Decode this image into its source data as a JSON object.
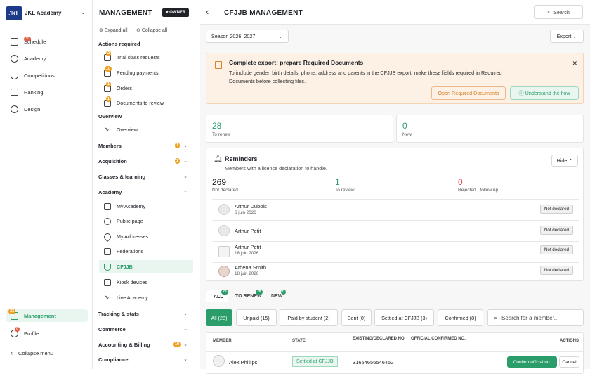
{
  "nav": {
    "logo": "JKL",
    "academy": "JKL Academy",
    "items": [
      {
        "label": "Schedule",
        "badge": "30"
      },
      {
        "label": "Academy",
        "badge": ""
      },
      {
        "label": "Competitions",
        "badge": ""
      },
      {
        "label": "Ranking",
        "badge": ""
      },
      {
        "label": "Design",
        "badge": ""
      }
    ],
    "management": {
      "label": "Management",
      "badge": "33"
    },
    "profile": {
      "label": "Profile",
      "badge": "6"
    },
    "collapse": "Collapse menu"
  },
  "mg": {
    "title": "MANAGEMENT",
    "owner": "OWNER",
    "expand": "Expand all",
    "collapse": "Collapse all",
    "actions_title": "Actions required",
    "actions": [
      {
        "label": "Trial class requests",
        "badge": "2"
      },
      {
        "label": "Pending payments",
        "badge": "10"
      },
      {
        "label": "Orders",
        "badge": "1"
      },
      {
        "label": "Documents to review",
        "badge": "1"
      }
    ],
    "overview_title": "Overview",
    "overview_item": "Overview",
    "sections": [
      {
        "label": "Members",
        "badge": "1"
      },
      {
        "label": "Acquisition",
        "badge": "1"
      },
      {
        "label": "Classes & learning",
        "badge": ""
      },
      {
        "label": "Academy",
        "badge": ""
      }
    ],
    "academy_items": [
      "My Academy",
      "Public page",
      "My Addresses",
      "Federations",
      "CFJJB",
      "Kiosk devices",
      "Live Academy"
    ],
    "bottom_sections": [
      {
        "label": "Tracking & stats",
        "badge": ""
      },
      {
        "label": "Commerce",
        "badge": ""
      },
      {
        "label": "Accounting & Billing",
        "badge": "10"
      },
      {
        "label": "Compliance",
        "badge": ""
      }
    ]
  },
  "main": {
    "title": "CFJJB MANAGEMENT",
    "search": "Search",
    "season": "Season 2026–2027",
    "export": "Export",
    "alert": {
      "title": "Complete export: prepare Required Documents",
      "text": "To include gender, birth details, phone, address and parents in the CFJJB export, make these fields required in Required Documents before collecting files.",
      "btn1": "Open Required Documents",
      "btn2": "Understand the flow"
    },
    "stats": [
      {
        "value": "28",
        "label": "To renew"
      },
      {
        "value": "0",
        "label": "New"
      }
    ],
    "reminders": {
      "title": "Reminders",
      "subtitle": "Members with a licence declaration to handle.",
      "hide": "Hide",
      "counts": [
        {
          "value": "269",
          "label": "Not declared"
        },
        {
          "value": "1",
          "label": "To review"
        },
        {
          "value": "0",
          "label": "Rejected · follow up"
        }
      ],
      "rows": [
        {
          "name": "Arthur Dubois",
          "date": "6 juin 2026",
          "status": "Not declared"
        },
        {
          "name": "Arthur Petit",
          "date": "",
          "status": "Not declared"
        },
        {
          "name": "Arthur Petit",
          "date": "18 juin 2026",
          "status": "Not declared"
        },
        {
          "name": "Athena Smith",
          "date": "18 juin 2026",
          "status": "Not declared"
        }
      ]
    },
    "tabs": [
      {
        "label": "ALL",
        "count": "28"
      },
      {
        "label": "TO RENEW",
        "count": "28"
      },
      {
        "label": "NEW",
        "count": "0"
      }
    ],
    "filters": [
      "All (28)",
      "Unpaid (15)",
      "Paid by student (2)",
      "Sent (0)",
      "Settled at CFJJB (3)",
      "Confirmed (8)"
    ],
    "member_search": "Search for a member...",
    "table": {
      "headers": [
        "MEMBER",
        "STATE",
        "EXISTING/DECLARED NO.",
        "OFFICIAL CONFIRMED NO.",
        "ACTIONS"
      ],
      "rows": [
        {
          "member": "Alex Phillips",
          "state": "Settled at CFJJB",
          "existing": "31654656546452",
          "official": "–",
          "confirm": "Confirm official no.",
          "cancel": "Cancel"
        }
      ]
    }
  },
  "colors": {
    "accent": "#2a9d6a",
    "badge_orange": "#f0a020",
    "badge_red": "#e25b3f",
    "alert_bg": "#fdf1e5",
    "danger": "#e04545"
  }
}
